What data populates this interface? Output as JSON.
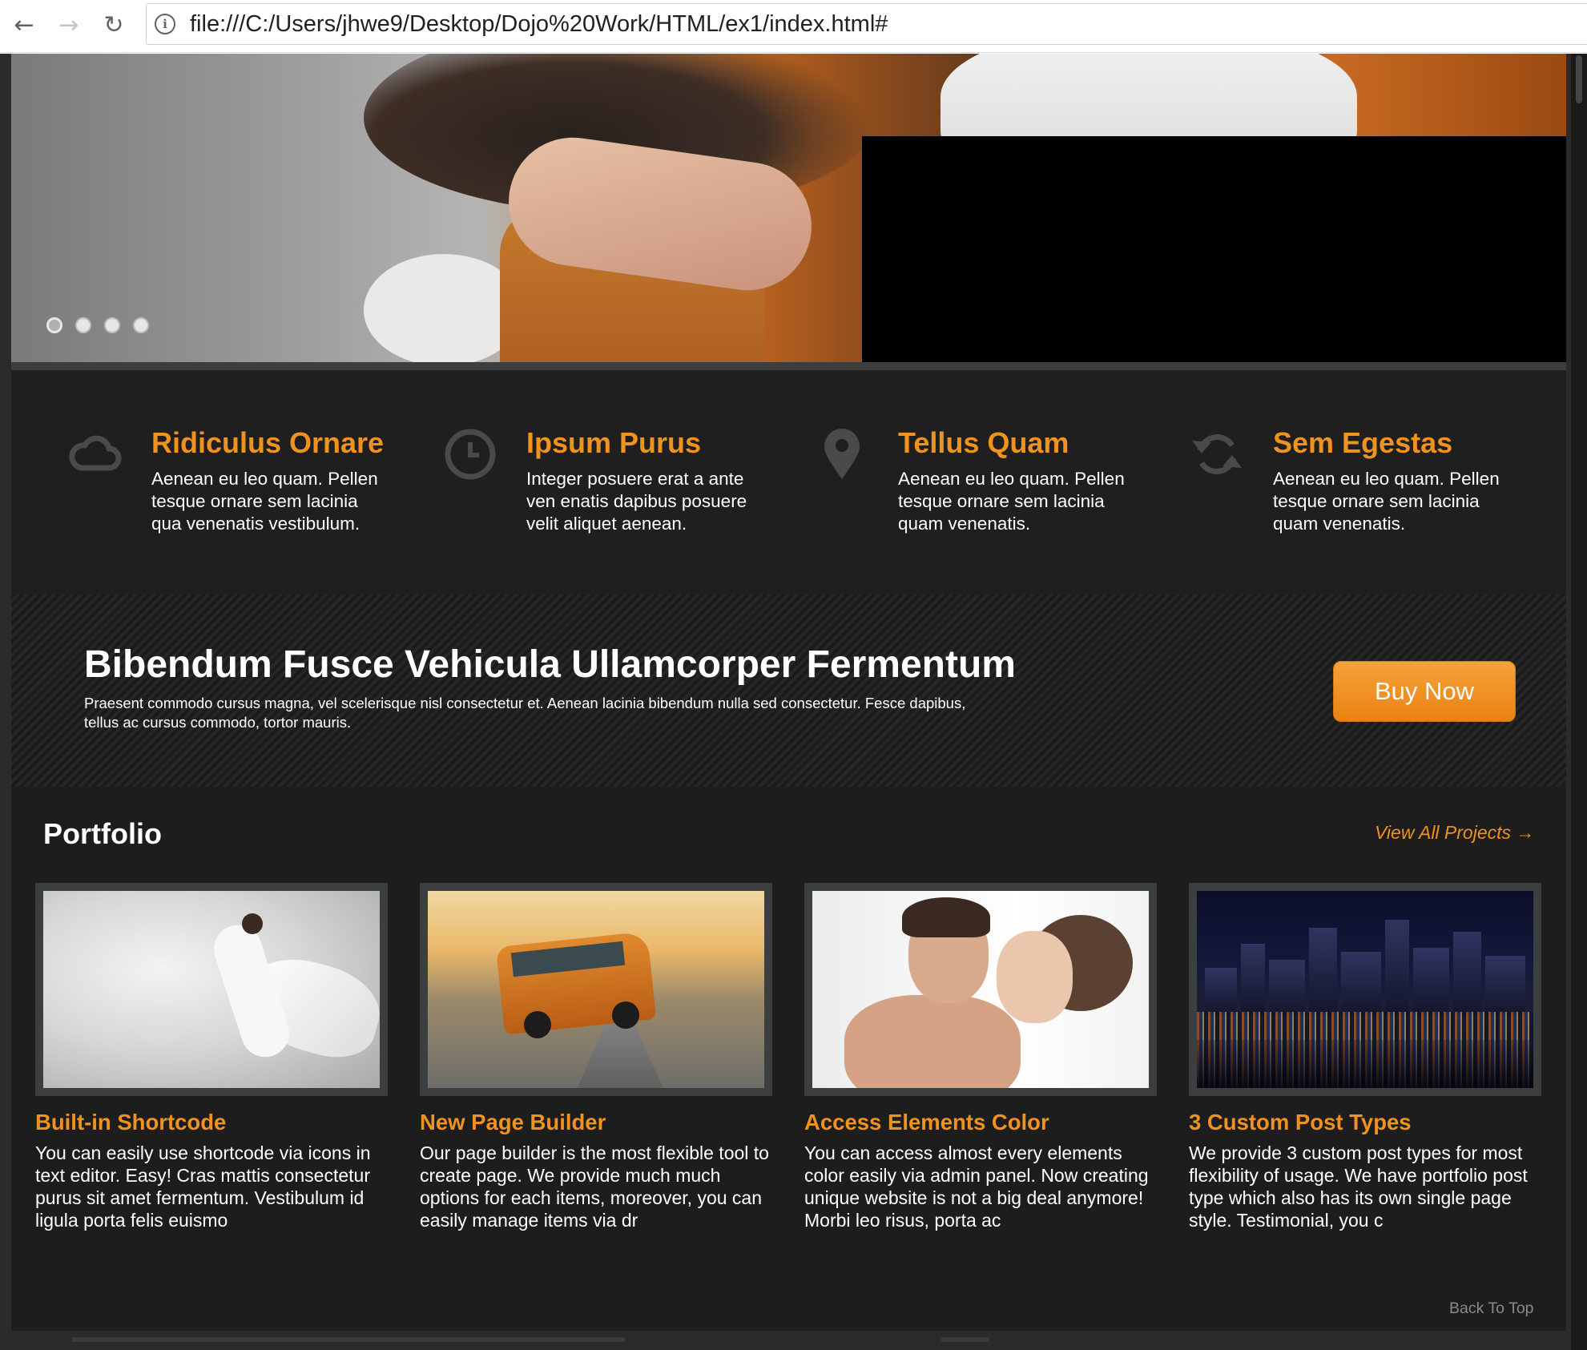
{
  "browser": {
    "url": "file:///C:/Users/jhwe9/Desktop/Dojo%20Work/HTML/ex1/index.html#",
    "icons": {
      "back": "arrow-left-icon",
      "forward": "arrow-right-icon",
      "reload": "reload-icon",
      "info": "info-icon"
    }
  },
  "hero": {
    "slide_count": 4,
    "active_slide": 1
  },
  "features": [
    {
      "icon": "cloud-icon",
      "title": "Ridiculus Ornare",
      "text": "Aenean eu leo quam. Pellen tesque ornare sem lacinia qua venenatis vestibulum."
    },
    {
      "icon": "clock-icon",
      "title": "Ipsum Purus",
      "text": "Integer posuere erat a ante ven enatis dapibus posuere velit aliquet aenean."
    },
    {
      "icon": "map-pin-icon",
      "title": "Tellus Quam",
      "text": "Aenean eu leo quam. Pellen tesque ornare sem lacinia quam venenatis."
    },
    {
      "icon": "refresh-icon",
      "title": "Sem Egestas",
      "text": "Aenean eu leo quam. Pellen tesque ornare sem lacinia quam venenatis."
    }
  ],
  "banner": {
    "title": "Bibendum Fusce Vehicula Ullamcorper Fermentum",
    "text": "Praesent commodo cursus magna, vel scelerisque nisl consectetur et. Aenean lacinia bibendum nulla sed consectetur. Fesce dapibus, tellus ac cursus commodo, tortor mauris.",
    "button_label": "Buy Now"
  },
  "portfolio": {
    "title": "Portfolio",
    "view_all_label": "View All Projects →",
    "items": [
      {
        "title": "Built-in Shortcode",
        "text": "You can easily use shortcode via icons in text editor. Easy! Cras mattis consectetur purus sit amet fermentum. Vestibulum id ligula porta felis euismo"
      },
      {
        "title": "New Page Builder",
        "text": "Our page builder is the most flexible tool to create page. We provide much much options for each items, moreover, you can easily manage items via dr"
      },
      {
        "title": "Access Elements Color",
        "text": "You can access almost every elements color easily via admin panel. Now creating unique website is not a big deal anymore! Morbi leo risus, porta ac"
      },
      {
        "title": "3 Custom Post Types",
        "text": "We provide 3 custom post types for most flexibility of usage. We have portfolio post type which also has its own single page style. Testimonial, you c"
      }
    ],
    "back_to_top_label": "Back To Top"
  },
  "colors": {
    "accent": "#f0921e",
    "page_bg": "#1a1a1a",
    "text": "#ffffff",
    "muted": "#8a8a8a"
  }
}
